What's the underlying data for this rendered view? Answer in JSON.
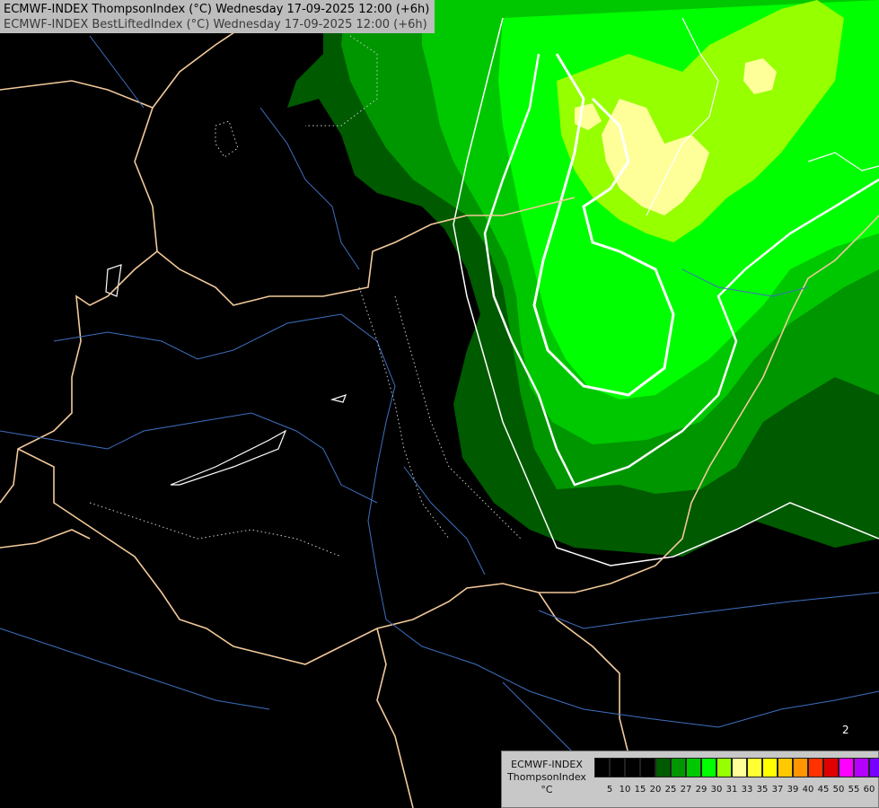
{
  "header": {
    "line1": "ECMWF-INDEX ThompsonIndex (°C) Wednesday 17-09-2025 12:00 (+6h)",
    "line2": "ECMWF-INDEX BestLiftedIndex (°C) Wednesday 17-09-2025 12:00 (+6h)"
  },
  "legend": {
    "model": "ECMWF-INDEX",
    "parameter": "ThompsonIndex",
    "unit": "°C",
    "colors": [
      "#000000",
      "#000000",
      "#000000",
      "#000000",
      "#005a00",
      "#009600",
      "#00c800",
      "#00ff00",
      "#96ff00",
      "#ffff9a",
      "#ffff32",
      "#ffff00",
      "#ffc800",
      "#ff9600",
      "#ff3200",
      "#e10000",
      "#ff00ff",
      "#b400ff",
      "#7800ff",
      "#5000ff",
      "#0000ff"
    ],
    "ticks": [
      "5",
      "10",
      "15",
      "20",
      "25",
      "27",
      "29",
      "30",
      "31",
      "33",
      "35",
      "37",
      "39",
      "40",
      "45",
      "50",
      "55",
      "60"
    ]
  },
  "map": {
    "contour_label": "2",
    "fill_colors": {
      "dark_green": "#005a00",
      "mid_green": "#009600",
      "green": "#00c800",
      "bright_green": "#00ff00",
      "lime": "#96ff00",
      "light_yellow": "#ffff9a"
    }
  }
}
